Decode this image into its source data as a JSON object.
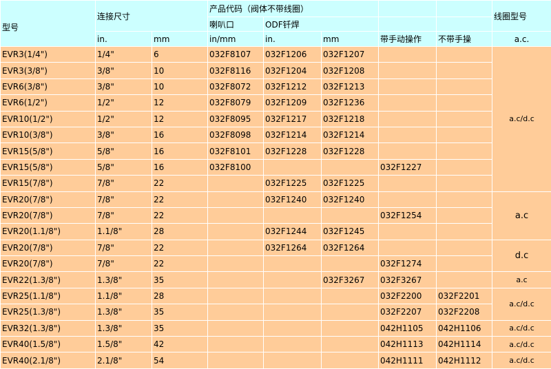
{
  "header": {
    "model": "型号",
    "connection_size": "连接尺寸",
    "product_code": "产品代码（阀体不带线圈）",
    "flare": "喇叭口",
    "odf": "ODF钎焊",
    "coil_model": "线圈型号",
    "in": "in.",
    "mm": "mm",
    "in_mm": "in/mm",
    "odf_in": "in.",
    "odf_mm": "mm",
    "manual": "带手动操作",
    "no_manual": "不带手操",
    "coil_ac": "a.c."
  },
  "rows": [
    {
      "model": "EVR3(1/4\")",
      "in": "1/4\"",
      "mm": "6",
      "flare": "032F8107",
      "odf_in": "032F1206",
      "odf_mm": "032F1207",
      "manual": "",
      "no_manual": ""
    },
    {
      "model": "EVR3(3/8\")",
      "in": "3/8\"",
      "mm": "10",
      "flare": "032F8116",
      "odf_in": "032F1204",
      "odf_mm": "032F1208",
      "manual": "",
      "no_manual": ""
    },
    {
      "model": "EVR6(3/8\")",
      "in": "3/8\"",
      "mm": "10",
      "flare": "032F8072",
      "odf_in": "032F1212",
      "odf_mm": "032F1213",
      "manual": "",
      "no_manual": ""
    },
    {
      "model": "EVR6(1/2\")",
      "in": "1/2\"",
      "mm": "12",
      "flare": "032F8079",
      "odf_in": "032F1209",
      "odf_mm": "032F1236",
      "manual": "",
      "no_manual": ""
    },
    {
      "model": "EVR10(1/2\")",
      "in": "1/2\"",
      "mm": "12",
      "flare": "032F8095",
      "odf_in": "032F1217",
      "odf_mm": "032F1218",
      "manual": "",
      "no_manual": ""
    },
    {
      "model": "EVR10(3/8\")",
      "in": "3/8\"",
      "mm": "16",
      "flare": "032F8098",
      "odf_in": "032F1214",
      "odf_mm": "032F1214",
      "manual": "",
      "no_manual": ""
    },
    {
      "model": "EVR15(5/8\")",
      "in": "5/8\"",
      "mm": "16",
      "flare": "032F8101",
      "odf_in": "032F1228",
      "odf_mm": "032F1228",
      "manual": "",
      "no_manual": ""
    },
    {
      "model": "EVR15(5/8\")",
      "in": "5/8\"",
      "mm": "16",
      "flare": "032F8100",
      "odf_in": "",
      "odf_mm": "",
      "manual": "032F1227",
      "no_manual": ""
    },
    {
      "model": "EVR15(7/8\")",
      "in": "7/8\"",
      "mm": "22",
      "flare": "",
      "odf_in": "032F1225",
      "odf_mm": "032F1225",
      "manual": "",
      "no_manual": ""
    },
    {
      "model": "EVR20(7/8\")",
      "in": "7/8\"",
      "mm": "22",
      "flare": "",
      "odf_in": "032F1240",
      "odf_mm": "032F1240",
      "manual": "",
      "no_manual": ""
    },
    {
      "model": "EVR20(7/8\")",
      "in": "7/8\"",
      "mm": "22",
      "flare": "",
      "odf_in": "",
      "odf_mm": "",
      "manual": "032F1254",
      "no_manual": ""
    },
    {
      "model": "EVR20(1.1/8\")",
      "in": "1.1/8\"",
      "mm": "28",
      "flare": "",
      "odf_in": "032F1244",
      "odf_mm": "032F1245",
      "manual": "",
      "no_manual": ""
    },
    {
      "model": "EVR20(7/8\")",
      "in": "7/8\"",
      "mm": "22",
      "flare": "",
      "odf_in": "032F1264",
      "odf_mm": "032F1264",
      "manual": "",
      "no_manual": ""
    },
    {
      "model": "EVR20(7/8\")",
      "in": "7/8\"",
      "mm": "22",
      "flare": "",
      "odf_in": "",
      "odf_mm": "",
      "manual": "032F1274",
      "no_manual": ""
    },
    {
      "model": "EVR22(1.3/8\")",
      "in": "1.3/8\"",
      "mm": "35",
      "flare": "",
      "odf_in": "",
      "odf_mm": "032F3267",
      "manual": "032F3267",
      "no_manual": ""
    },
    {
      "model": "EVR25(1.1/8\")",
      "in": "1.1/8\"",
      "mm": "28",
      "flare": "",
      "odf_in": "",
      "odf_mm": "",
      "manual": "032F2200",
      "no_manual": "032F2201"
    },
    {
      "model": "EVR25(1.3/8\")",
      "in": "1.3/8\"",
      "mm": "35",
      "flare": "",
      "odf_in": "",
      "odf_mm": "",
      "manual": "032F2207",
      "no_manual": "032F2208"
    },
    {
      "model": "EVR32(1.3/8\")",
      "in": "1.3/8\"",
      "mm": "35",
      "flare": "",
      "odf_in": "",
      "odf_mm": "",
      "manual": "042H1105",
      "no_manual": "042H1106"
    },
    {
      "model": "EVR40(1.5/8\")",
      "in": "1.5/8\"",
      "mm": "42",
      "flare": "",
      "odf_in": "",
      "odf_mm": "",
      "manual": "042H1113",
      "no_manual": "042H1114"
    },
    {
      "model": "EVR40(2.1/8\")",
      "in": "2.1/8\"",
      "mm": "54",
      "flare": "",
      "odf_in": "",
      "odf_mm": "",
      "manual": "042H1111",
      "no_manual": "042H1112"
    }
  ],
  "coil_groups": [
    "a.c/d.c",
    "a.c",
    "d.c",
    "a.c",
    "a.c/d.c",
    "a.c/d.c",
    "a.c/d.c",
    "a.c/d.c"
  ]
}
